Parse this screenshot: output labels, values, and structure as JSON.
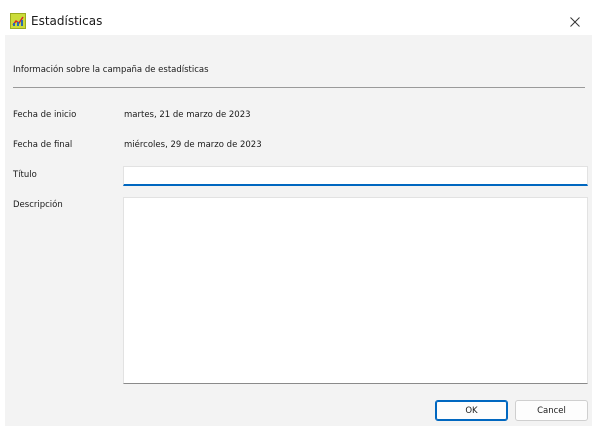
{
  "window": {
    "title": "Estadísticas",
    "app_icon": "statistics-chart-icon",
    "close_icon": "close-icon",
    "accent_color": "#0067c0"
  },
  "section": {
    "header": "Información sobre la campaña de estadísticas"
  },
  "fields": {
    "start_date": {
      "label": "Fecha de inicio",
      "value": "martes, 21 de marzo de 2023"
    },
    "end_date": {
      "label": "Fecha de final",
      "value": "miércoles, 29 de marzo de 2023"
    },
    "title": {
      "label": "Título",
      "value": ""
    },
    "description": {
      "label": "Descripción",
      "value": ""
    }
  },
  "buttons": {
    "ok": "OK",
    "cancel": "Cancel"
  }
}
